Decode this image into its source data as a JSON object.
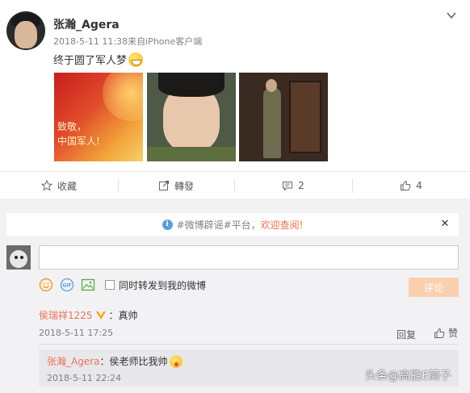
{
  "post": {
    "author": "张瀚_Agera",
    "date": "2018-5-11 11:38",
    "source": "来自iPhone客户端",
    "text": "终于圆了军人梦",
    "photos": [
      {
        "caption_line1": "致敬，",
        "caption_line2": "中国军人!"
      },
      {},
      {}
    ]
  },
  "actions": {
    "favorite": "收藏",
    "repost": "轉發",
    "comment_count": "2",
    "like_count": "4"
  },
  "notice": {
    "prefix": "#微博辟谣#平台，",
    "link": "欢迎查阅!"
  },
  "composer": {
    "placeholder": "",
    "repost_checkbox_label": "同时转发到我的微博",
    "submit_label": "评论"
  },
  "comment": {
    "user": "侯瑞祥1225",
    "text": "：真帅",
    "time": "2018-5-11 17:25",
    "reply_label": "回复",
    "like_label": "赞"
  },
  "subreply": {
    "user": "张瀚_Agera",
    "text": "：侯老师比我帅",
    "time": "2018-5-11 22:24"
  },
  "watermark": "头条@高能E筒子",
  "colors": {
    "link_orange": "#eb7350",
    "submit_disabled": "#fbd0b0",
    "comment_bg": "#f2f2f5"
  }
}
